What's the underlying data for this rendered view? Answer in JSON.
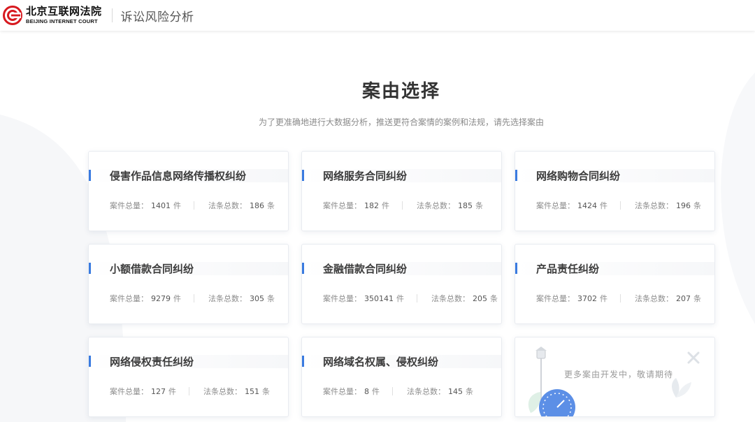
{
  "header": {
    "logo_cn": "北京互联网法院",
    "logo_en": "BEIJING INTERNET COURT",
    "title": "诉讼风险分析"
  },
  "main": {
    "title": "案由选择",
    "subtitle": "为了更准确地进行大数据分析，推送更符合案情的案例和法规，请先选择案由"
  },
  "labels": {
    "cases_label": "案件总量：",
    "cases_unit": "件",
    "laws_label": "法条总数：",
    "laws_unit": "条"
  },
  "cards": [
    {
      "title": "侵害作品信息网络传播权纠纷",
      "cases": "1401",
      "laws": "186"
    },
    {
      "title": "网络服务合同纠纷",
      "cases": "182",
      "laws": "185"
    },
    {
      "title": "网络购物合同纠纷",
      "cases": "1424",
      "laws": "196"
    },
    {
      "title": "小额借款合同纠纷",
      "cases": "9279",
      "laws": "305"
    },
    {
      "title": "金融借款合同纠纷",
      "cases": "350141",
      "laws": "205"
    },
    {
      "title": "产品责任纠纷",
      "cases": "3702",
      "laws": "207"
    },
    {
      "title": "网络侵权责任纠纷",
      "cases": "127",
      "laws": "151"
    },
    {
      "title": "网络域名权属、侵权纠纷",
      "cases": "8",
      "laws": "145"
    }
  ],
  "placeholder": {
    "text": "更多案由开发中，敬请期待"
  },
  "colors": {
    "accent": "#3a7be0",
    "brand_red": "#d7191f"
  }
}
